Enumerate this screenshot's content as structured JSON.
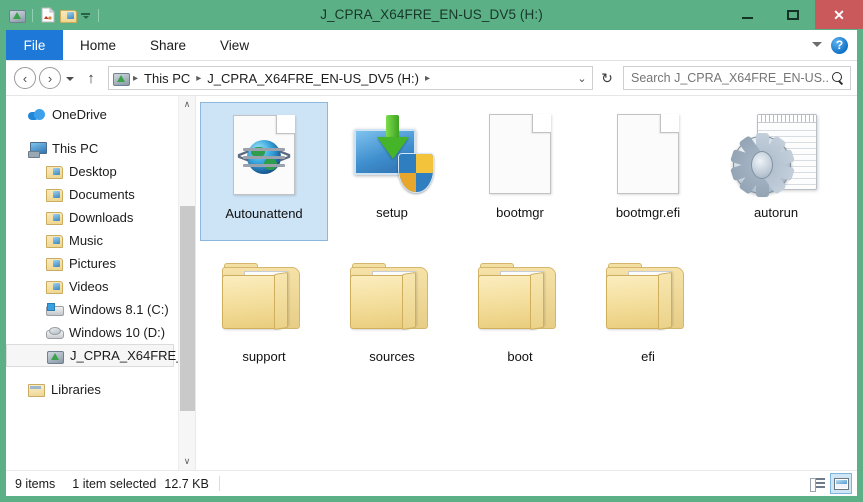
{
  "window": {
    "title": "J_CPRA_X64FRE_EN-US_DV5 (H:)",
    "accent_green": "#5cb085",
    "close_red": "#c9595b",
    "selection_blue": "#cde3f6"
  },
  "quick_access": {
    "items": [
      {
        "name": "drive-icon",
        "label": "J_CPRA_X64FRE_EN-US_DV5 (H:)"
      },
      {
        "name": "properties-icon",
        "label": "Properties"
      },
      {
        "name": "new-folder-icon",
        "label": "New folder"
      },
      {
        "name": "customize-qat-icon",
        "label": "Customize Quick Access Toolbar"
      }
    ]
  },
  "window_controls": {
    "minimize": "—",
    "maximize": "❑",
    "close": "✕"
  },
  "ribbon": {
    "file_tab": "File",
    "tabs": [
      "Home",
      "Share",
      "View"
    ],
    "expand_label": "Expand the Ribbon",
    "help_label": "?"
  },
  "navigation": {
    "back": "‹",
    "forward": "›",
    "recent_label": "Recent locations",
    "up": "↑",
    "breadcrumbs": [
      "This PC",
      "J_CPRA_X64FRE_EN-US_DV5 (H:)"
    ],
    "separator": "▸",
    "dropdown": "⌄",
    "refresh": "↻"
  },
  "search": {
    "placeholder": "Search J_CPRA_X64FRE_EN-US...",
    "value": ""
  },
  "sidebar": {
    "scroll_up": "∧",
    "scroll_down": "∨",
    "items": [
      {
        "label": "OneDrive",
        "icon": "onedrive-icon",
        "level": 0,
        "selected": false
      },
      {
        "label": "This PC",
        "icon": "this-pc-icon",
        "level": 0,
        "selected": false
      },
      {
        "label": "Desktop",
        "icon": "desktop-folder-icon",
        "level": 1,
        "selected": false
      },
      {
        "label": "Documents",
        "icon": "documents-folder-icon",
        "level": 1,
        "selected": false
      },
      {
        "label": "Downloads",
        "icon": "downloads-folder-icon",
        "level": 1,
        "selected": false
      },
      {
        "label": "Music",
        "icon": "music-folder-icon",
        "level": 1,
        "selected": false
      },
      {
        "label": "Pictures",
        "icon": "pictures-folder-icon",
        "level": 1,
        "selected": false
      },
      {
        "label": "Videos",
        "icon": "videos-folder-icon",
        "level": 1,
        "selected": false
      },
      {
        "label": "Windows 8.1 (C:)",
        "icon": "windows-drive-icon",
        "level": 1,
        "selected": false
      },
      {
        "label": "Windows 10 (D:)",
        "icon": "disk-drive-icon",
        "level": 1,
        "selected": false
      },
      {
        "label": "J_CPRA_X64FRE_...",
        "icon": "optical-drive-icon",
        "level": 1,
        "selected": true
      },
      {
        "label": "Libraries",
        "icon": "libraries-icon",
        "level": 0,
        "selected": false
      }
    ]
  },
  "files": [
    {
      "name": "Autounattend",
      "type": "xml-document",
      "selected": true
    },
    {
      "name": "setup",
      "type": "application-shield",
      "selected": false
    },
    {
      "name": "bootmgr",
      "type": "blank-file",
      "selected": false
    },
    {
      "name": "bootmgr.efi",
      "type": "blank-file",
      "selected": false
    },
    {
      "name": "autorun",
      "type": "inf-file",
      "selected": false
    },
    {
      "name": "support",
      "type": "folder",
      "selected": false
    },
    {
      "name": "sources",
      "type": "folder-cog",
      "selected": false
    },
    {
      "name": "boot",
      "type": "folder",
      "selected": false
    },
    {
      "name": "efi",
      "type": "folder",
      "selected": false
    }
  ],
  "status_bar": {
    "item_count": "9 items",
    "selection": "1 item selected",
    "size": "12.7 KB",
    "view_details_label": "Details view",
    "view_large_icons_label": "Large icons view",
    "active_view": "large-icons"
  }
}
